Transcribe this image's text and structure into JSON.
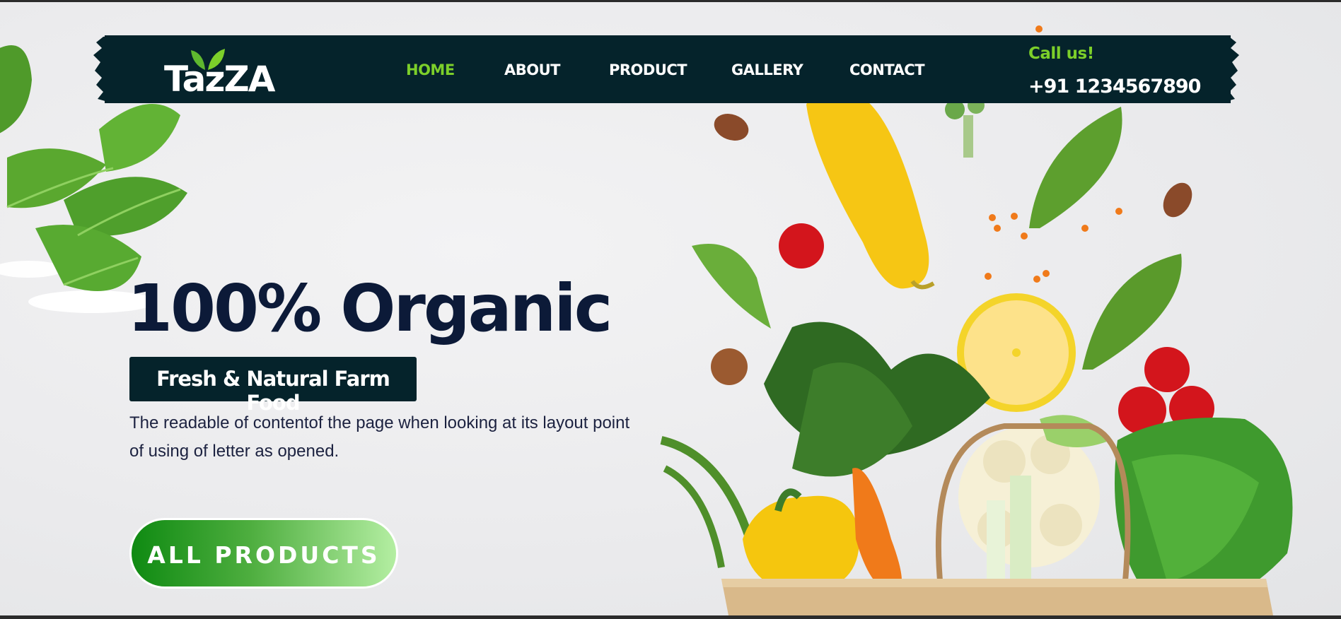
{
  "brand": {
    "name": "TazZA"
  },
  "nav": {
    "items": [
      {
        "label": "HOME",
        "active": true
      },
      {
        "label": "ABOUT",
        "active": false
      },
      {
        "label": "PRODUCT",
        "active": false
      },
      {
        "label": "GALLERY",
        "active": false
      },
      {
        "label": "CONTACT",
        "active": false
      }
    ]
  },
  "contact": {
    "call_label": "Call us!",
    "phone": "+91 1234567890"
  },
  "hero": {
    "title": "100% Organic",
    "badge": "Fresh & Natural Farm Food",
    "description_line1": "The readable of contentof the page when looking at its layout point",
    "description_line2": "of using of letter as opened.",
    "cta_label": "ALL PRODUCTS"
  },
  "colors": {
    "nav_bg": "#05232b",
    "accent_green": "#7ccf2a",
    "title_navy": "#0c1a38",
    "cta_start": "#0f8a12",
    "cta_end": "#b4eea2"
  },
  "icons": {
    "logo_leaf": "logo-leaf-icon",
    "hero_image": "vegetables-bag-image",
    "spinach": "spinach-leaves-image"
  }
}
